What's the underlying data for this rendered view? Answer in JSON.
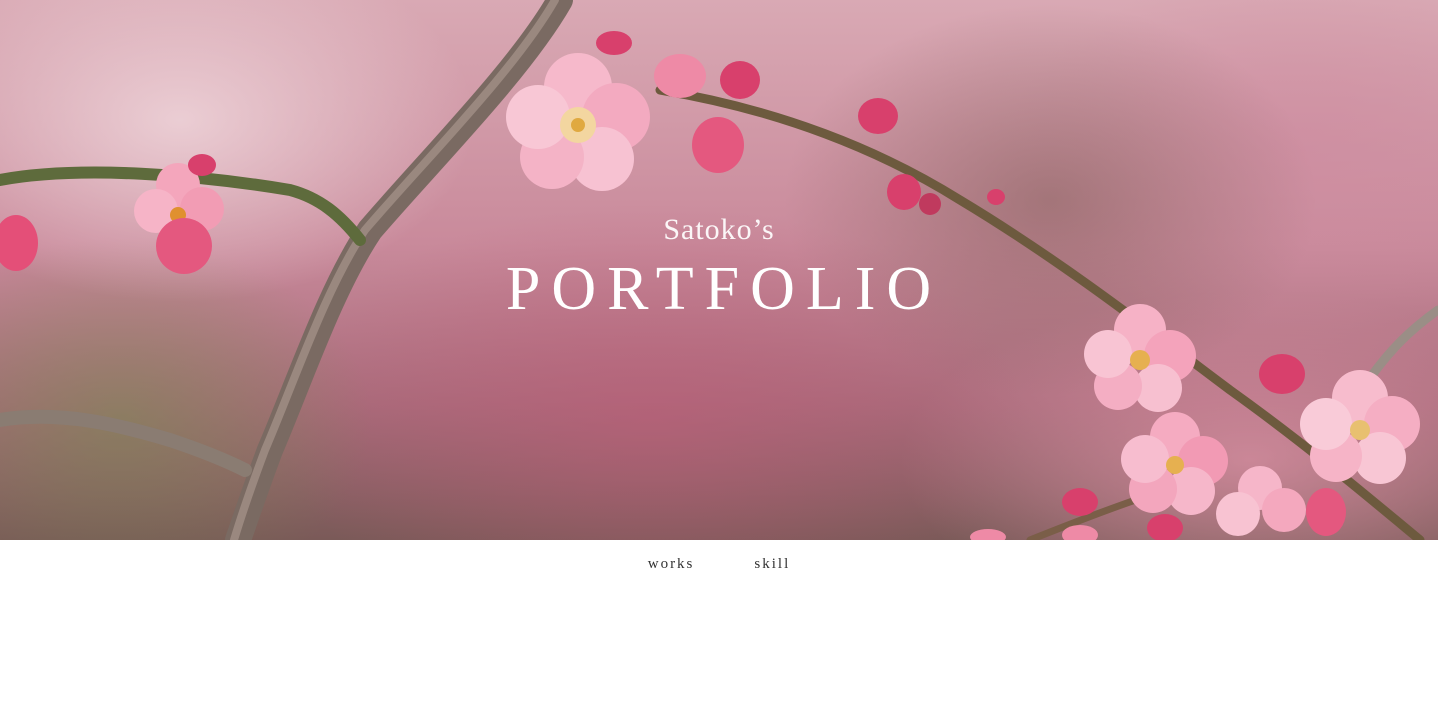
{
  "hero": {
    "subtitle": "Satoko’s",
    "title": "PORTFOLIO"
  },
  "nav": {
    "items": [
      {
        "label": "works"
      },
      {
        "label": "skill"
      }
    ]
  },
  "colors": {
    "blossom_pink": "#f4a7bd",
    "bud_magenta": "#d43d6a",
    "branch_brown": "#6b5a4a",
    "nav_text": "#333333"
  }
}
